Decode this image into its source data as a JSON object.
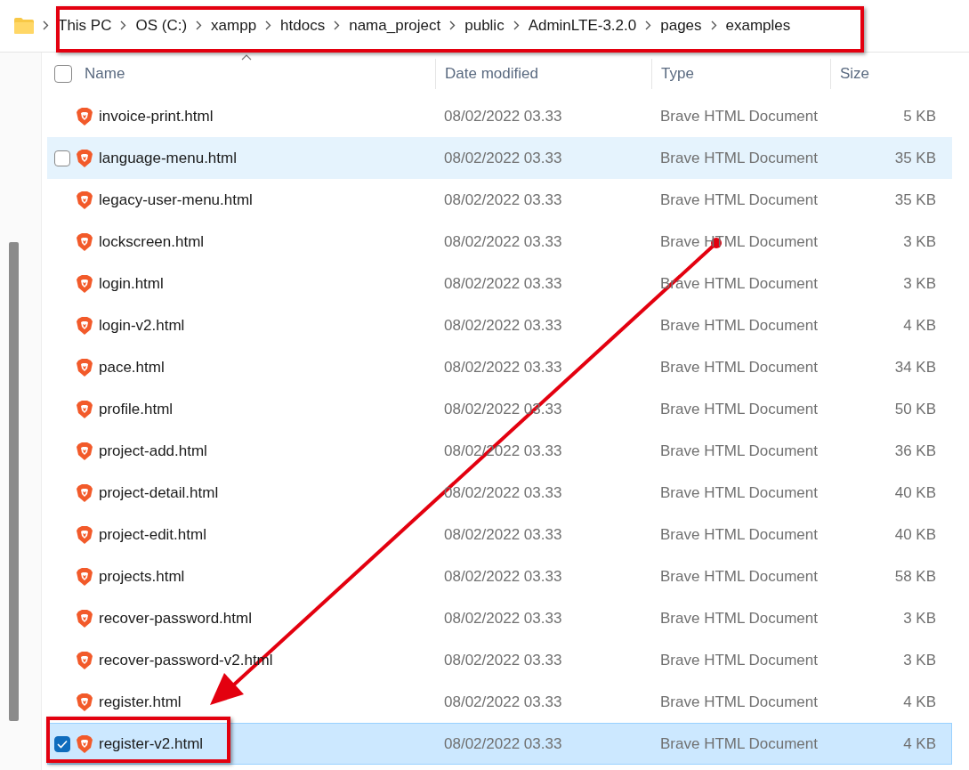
{
  "breadcrumb": [
    "This PC",
    "OS (C:)",
    "xampp",
    "htdocs",
    "nama_project",
    "public",
    "AdminLTE-3.2.0",
    "pages",
    "examples"
  ],
  "columns": [
    {
      "label": "Name",
      "sorted": true
    },
    {
      "label": "Date modified",
      "sorted": false
    },
    {
      "label": "Type",
      "sorted": false
    },
    {
      "label": "Size",
      "sorted": false
    }
  ],
  "header_checked": false,
  "rows": [
    {
      "name": "invoice-print.html",
      "date": "08/02/2022 03.33",
      "type": "Brave HTML Document",
      "size": "5 KB",
      "hovered": false,
      "selected": false
    },
    {
      "name": "language-menu.html",
      "date": "08/02/2022 03.33",
      "type": "Brave HTML Document",
      "size": "35 KB",
      "hovered": true,
      "selected": false
    },
    {
      "name": "legacy-user-menu.html",
      "date": "08/02/2022 03.33",
      "type": "Brave HTML Document",
      "size": "35 KB",
      "hovered": false,
      "selected": false
    },
    {
      "name": "lockscreen.html",
      "date": "08/02/2022 03.33",
      "type": "Brave HTML Document",
      "size": "3 KB",
      "hovered": false,
      "selected": false
    },
    {
      "name": "login.html",
      "date": "08/02/2022 03.33",
      "type": "Brave HTML Document",
      "size": "3 KB",
      "hovered": false,
      "selected": false
    },
    {
      "name": "login-v2.html",
      "date": "08/02/2022 03.33",
      "type": "Brave HTML Document",
      "size": "4 KB",
      "hovered": false,
      "selected": false
    },
    {
      "name": "pace.html",
      "date": "08/02/2022 03.33",
      "type": "Brave HTML Document",
      "size": "34 KB",
      "hovered": false,
      "selected": false
    },
    {
      "name": "profile.html",
      "date": "08/02/2022 03.33",
      "type": "Brave HTML Document",
      "size": "50 KB",
      "hovered": false,
      "selected": false
    },
    {
      "name": "project-add.html",
      "date": "08/02/2022 03.33",
      "type": "Brave HTML Document",
      "size": "36 KB",
      "hovered": false,
      "selected": false
    },
    {
      "name": "project-detail.html",
      "date": "08/02/2022 03.33",
      "type": "Brave HTML Document",
      "size": "40 KB",
      "hovered": false,
      "selected": false
    },
    {
      "name": "project-edit.html",
      "date": "08/02/2022 03.33",
      "type": "Brave HTML Document",
      "size": "40 KB",
      "hovered": false,
      "selected": false
    },
    {
      "name": "projects.html",
      "date": "08/02/2022 03.33",
      "type": "Brave HTML Document",
      "size": "58 KB",
      "hovered": false,
      "selected": false
    },
    {
      "name": "recover-password.html",
      "date": "08/02/2022 03.33",
      "type": "Brave HTML Document",
      "size": "3 KB",
      "hovered": false,
      "selected": false
    },
    {
      "name": "recover-password-v2.html",
      "date": "08/02/2022 03.33",
      "type": "Brave HTML Document",
      "size": "3 KB",
      "hovered": false,
      "selected": false
    },
    {
      "name": "register.html",
      "date": "08/02/2022 03.33",
      "type": "Brave HTML Document",
      "size": "4 KB",
      "hovered": false,
      "selected": false
    },
    {
      "name": "register-v2.html",
      "date": "08/02/2022 03.33",
      "type": "Brave HTML Document",
      "size": "4 KB",
      "hovered": false,
      "selected": true
    }
  ]
}
